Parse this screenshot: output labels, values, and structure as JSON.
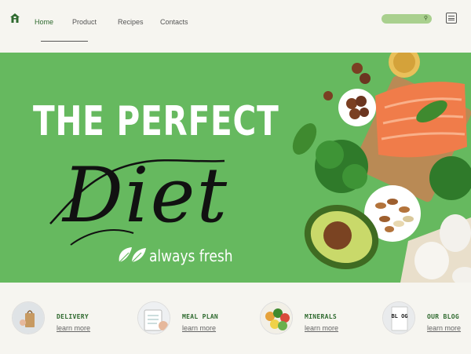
{
  "nav": {
    "logo_icon": "home-icon",
    "links": [
      {
        "label": "Home",
        "active": true
      },
      {
        "label": "Product",
        "active": false
      },
      {
        "label": "Recipes",
        "active": false
      },
      {
        "label": "Contacts",
        "active": false
      }
    ],
    "search_icon": "search-icon",
    "menu_icon": "hamburger-menu-icon"
  },
  "hero": {
    "title": "THE PERFECT",
    "script_word": "Diet",
    "tagline": "always fresh",
    "tagline_icon": "leaf-icon"
  },
  "features": [
    {
      "title": "DELIVERY",
      "link": "learn more",
      "icon": "delivery-bag-image"
    },
    {
      "title": "MEAL PLAN",
      "link": "learn more",
      "icon": "meal-plan-notebook-image"
    },
    {
      "title": "MINERALS",
      "link": "learn more",
      "icon": "minerals-image"
    },
    {
      "title": "OUR BLOG",
      "link": "learn more",
      "icon": "blog-card-image",
      "icon_text": "BL OG"
    }
  ],
  "colors": {
    "background": "#f6f5f0",
    "hero_green": "#66b95f",
    "accent_green": "#2f6a2f",
    "search_green": "#a9d08e"
  }
}
